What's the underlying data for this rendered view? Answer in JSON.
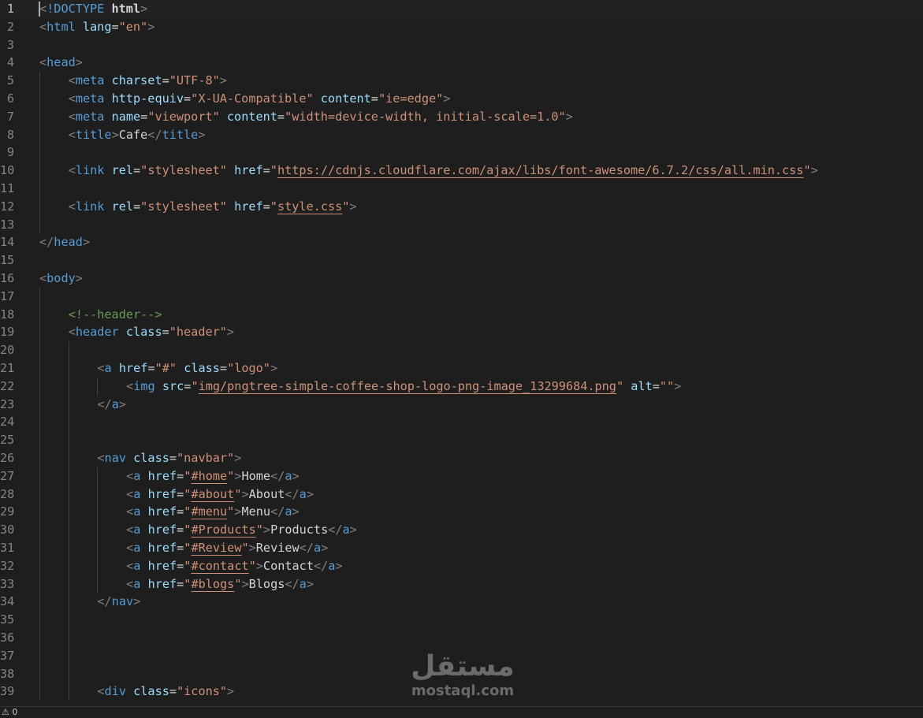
{
  "editor": {
    "language": "html",
    "active_line": 1,
    "lines": [
      {
        "n": "1",
        "indent": 0,
        "tokens": [
          [
            "punct",
            "<"
          ],
          [
            "doctype",
            "!DOCTYPE"
          ],
          [
            "text",
            " "
          ],
          [
            "bold",
            "html"
          ],
          [
            "punct",
            ">"
          ]
        ]
      },
      {
        "n": "2",
        "indent": 0,
        "tokens": [
          [
            "punct",
            "<"
          ],
          [
            "tag",
            "html"
          ],
          [
            "text",
            " "
          ],
          [
            "attr",
            "lang"
          ],
          [
            "text",
            "="
          ],
          [
            "str",
            "\"en\""
          ],
          [
            "punct",
            ">"
          ]
        ]
      },
      {
        "n": "3",
        "indent": 0,
        "tokens": []
      },
      {
        "n": "4",
        "indent": 0,
        "tokens": [
          [
            "punct",
            "<"
          ],
          [
            "tag",
            "head"
          ],
          [
            "punct",
            ">"
          ]
        ]
      },
      {
        "n": "5",
        "indent": 1,
        "tokens": [
          [
            "punct",
            "<"
          ],
          [
            "tag",
            "meta"
          ],
          [
            "text",
            " "
          ],
          [
            "attr",
            "charset"
          ],
          [
            "text",
            "="
          ],
          [
            "str",
            "\"UTF-8\""
          ],
          [
            "punct",
            ">"
          ]
        ]
      },
      {
        "n": "6",
        "indent": 1,
        "tokens": [
          [
            "punct",
            "<"
          ],
          [
            "tag",
            "meta"
          ],
          [
            "text",
            " "
          ],
          [
            "attr",
            "http-equiv"
          ],
          [
            "text",
            "="
          ],
          [
            "str",
            "\"X-UA-Compatible\""
          ],
          [
            "text",
            " "
          ],
          [
            "attr",
            "content"
          ],
          [
            "text",
            "="
          ],
          [
            "str",
            "\"ie=edge\""
          ],
          [
            "punct",
            ">"
          ]
        ]
      },
      {
        "n": "7",
        "indent": 1,
        "tokens": [
          [
            "punct",
            "<"
          ],
          [
            "tag",
            "meta"
          ],
          [
            "text",
            " "
          ],
          [
            "attr",
            "name"
          ],
          [
            "text",
            "="
          ],
          [
            "str",
            "\"viewport\""
          ],
          [
            "text",
            " "
          ],
          [
            "attr",
            "content"
          ],
          [
            "text",
            "="
          ],
          [
            "str",
            "\"width=device-width, initial-scale=1.0\""
          ],
          [
            "punct",
            ">"
          ]
        ]
      },
      {
        "n": "8",
        "indent": 1,
        "tokens": [
          [
            "punct",
            "<"
          ],
          [
            "tag",
            "title"
          ],
          [
            "punct",
            ">"
          ],
          [
            "text",
            "Cafe"
          ],
          [
            "punct",
            "</"
          ],
          [
            "tag",
            "title"
          ],
          [
            "punct",
            ">"
          ]
        ]
      },
      {
        "n": "9",
        "indent": 1,
        "tokens": []
      },
      {
        "n": "10",
        "indent": 1,
        "tokens": [
          [
            "punct",
            "<"
          ],
          [
            "tag",
            "link"
          ],
          [
            "text",
            " "
          ],
          [
            "attr",
            "rel"
          ],
          [
            "text",
            "="
          ],
          [
            "str",
            "\"stylesheet\""
          ],
          [
            "text",
            " "
          ],
          [
            "attr",
            "href"
          ],
          [
            "text",
            "="
          ],
          [
            "str",
            "\""
          ],
          [
            "link",
            "https://cdnjs.cloudflare.com/ajax/libs/font-awesome/6.7.2/css/all.min.css"
          ],
          [
            "str",
            "\""
          ],
          [
            "punct",
            ">"
          ]
        ]
      },
      {
        "n": "11",
        "indent": 1,
        "tokens": []
      },
      {
        "n": "12",
        "indent": 1,
        "tokens": [
          [
            "punct",
            "<"
          ],
          [
            "tag",
            "link"
          ],
          [
            "text",
            " "
          ],
          [
            "attr",
            "rel"
          ],
          [
            "text",
            "="
          ],
          [
            "str",
            "\"stylesheet\""
          ],
          [
            "text",
            " "
          ],
          [
            "attr",
            "href"
          ],
          [
            "text",
            "="
          ],
          [
            "str",
            "\""
          ],
          [
            "link",
            "style.css"
          ],
          [
            "str",
            "\""
          ],
          [
            "punct",
            ">"
          ]
        ]
      },
      {
        "n": "13",
        "indent": 1,
        "tokens": []
      },
      {
        "n": "14",
        "indent": 0,
        "tokens": [
          [
            "punct",
            "</"
          ],
          [
            "tag",
            "head"
          ],
          [
            "punct",
            ">"
          ]
        ]
      },
      {
        "n": "15",
        "indent": 0,
        "tokens": []
      },
      {
        "n": "16",
        "indent": 0,
        "tokens": [
          [
            "punct",
            "<"
          ],
          [
            "tag",
            "body"
          ],
          [
            "punct",
            ">"
          ]
        ]
      },
      {
        "n": "17",
        "indent": 1,
        "tokens": []
      },
      {
        "n": "18",
        "indent": 1,
        "tokens": [
          [
            "comment",
            "<!--header-->"
          ]
        ]
      },
      {
        "n": "19",
        "indent": 1,
        "tokens": [
          [
            "punct",
            "<"
          ],
          [
            "tag",
            "header"
          ],
          [
            "text",
            " "
          ],
          [
            "attr",
            "class"
          ],
          [
            "text",
            "="
          ],
          [
            "str",
            "\"header\""
          ],
          [
            "punct",
            ">"
          ]
        ]
      },
      {
        "n": "20",
        "indent": 2,
        "tokens": []
      },
      {
        "n": "21",
        "indent": 2,
        "tokens": [
          [
            "punct",
            "<"
          ],
          [
            "tag",
            "a"
          ],
          [
            "text",
            " "
          ],
          [
            "attr",
            "href"
          ],
          [
            "text",
            "="
          ],
          [
            "str",
            "\"#\""
          ],
          [
            "text",
            " "
          ],
          [
            "attr",
            "class"
          ],
          [
            "text",
            "="
          ],
          [
            "str",
            "\"logo\""
          ],
          [
            "punct",
            ">"
          ]
        ]
      },
      {
        "n": "22",
        "indent": 3,
        "tokens": [
          [
            "punct",
            "<"
          ],
          [
            "tag",
            "img"
          ],
          [
            "text",
            " "
          ],
          [
            "attr",
            "src"
          ],
          [
            "text",
            "="
          ],
          [
            "str",
            "\""
          ],
          [
            "link",
            "img/pngtree-simple-coffee-shop-logo-png-image_13299684.png"
          ],
          [
            "str",
            "\""
          ],
          [
            "text",
            " "
          ],
          [
            "attr",
            "alt"
          ],
          [
            "text",
            "="
          ],
          [
            "str",
            "\"\""
          ],
          [
            "punct",
            ">"
          ]
        ]
      },
      {
        "n": "23",
        "indent": 2,
        "tokens": [
          [
            "punct",
            "</"
          ],
          [
            "tag",
            "a"
          ],
          [
            "punct",
            ">"
          ]
        ]
      },
      {
        "n": "24",
        "indent": 2,
        "tokens": []
      },
      {
        "n": "25",
        "indent": 2,
        "tokens": []
      },
      {
        "n": "26",
        "indent": 2,
        "tokens": [
          [
            "punct",
            "<"
          ],
          [
            "tag",
            "nav"
          ],
          [
            "text",
            " "
          ],
          [
            "attr",
            "class"
          ],
          [
            "text",
            "="
          ],
          [
            "str",
            "\"navbar\""
          ],
          [
            "punct",
            ">"
          ]
        ]
      },
      {
        "n": "27",
        "indent": 3,
        "tokens": [
          [
            "punct",
            "<"
          ],
          [
            "tag",
            "a"
          ],
          [
            "text",
            " "
          ],
          [
            "attr",
            "href"
          ],
          [
            "text",
            "="
          ],
          [
            "str",
            "\""
          ],
          [
            "link",
            "#home"
          ],
          [
            "str",
            "\""
          ],
          [
            "punct",
            ">"
          ],
          [
            "text",
            "Home"
          ],
          [
            "punct",
            "</"
          ],
          [
            "tag",
            "a"
          ],
          [
            "punct",
            ">"
          ]
        ]
      },
      {
        "n": "28",
        "indent": 3,
        "tokens": [
          [
            "punct",
            "<"
          ],
          [
            "tag",
            "a"
          ],
          [
            "text",
            " "
          ],
          [
            "attr",
            "href"
          ],
          [
            "text",
            "="
          ],
          [
            "str",
            "\""
          ],
          [
            "link",
            "#about"
          ],
          [
            "str",
            "\""
          ],
          [
            "punct",
            ">"
          ],
          [
            "text",
            "About"
          ],
          [
            "punct",
            "</"
          ],
          [
            "tag",
            "a"
          ],
          [
            "punct",
            ">"
          ]
        ]
      },
      {
        "n": "29",
        "indent": 3,
        "tokens": [
          [
            "punct",
            "<"
          ],
          [
            "tag",
            "a"
          ],
          [
            "text",
            " "
          ],
          [
            "attr",
            "href"
          ],
          [
            "text",
            "="
          ],
          [
            "str",
            "\""
          ],
          [
            "link",
            "#menu"
          ],
          [
            "str",
            "\""
          ],
          [
            "punct",
            ">"
          ],
          [
            "text",
            "Menu"
          ],
          [
            "punct",
            "</"
          ],
          [
            "tag",
            "a"
          ],
          [
            "punct",
            ">"
          ]
        ]
      },
      {
        "n": "30",
        "indent": 3,
        "tokens": [
          [
            "punct",
            "<"
          ],
          [
            "tag",
            "a"
          ],
          [
            "text",
            " "
          ],
          [
            "attr",
            "href"
          ],
          [
            "text",
            "="
          ],
          [
            "str",
            "\""
          ],
          [
            "link",
            "#Products"
          ],
          [
            "str",
            "\""
          ],
          [
            "punct",
            ">"
          ],
          [
            "text",
            "Products"
          ],
          [
            "punct",
            "</"
          ],
          [
            "tag",
            "a"
          ],
          [
            "punct",
            ">"
          ]
        ]
      },
      {
        "n": "31",
        "indent": 3,
        "tokens": [
          [
            "punct",
            "<"
          ],
          [
            "tag",
            "a"
          ],
          [
            "text",
            " "
          ],
          [
            "attr",
            "href"
          ],
          [
            "text",
            "="
          ],
          [
            "str",
            "\""
          ],
          [
            "link",
            "#Review"
          ],
          [
            "str",
            "\""
          ],
          [
            "punct",
            ">"
          ],
          [
            "text",
            "Review"
          ],
          [
            "punct",
            "</"
          ],
          [
            "tag",
            "a"
          ],
          [
            "punct",
            ">"
          ]
        ]
      },
      {
        "n": "32",
        "indent": 3,
        "tokens": [
          [
            "punct",
            "<"
          ],
          [
            "tag",
            "a"
          ],
          [
            "text",
            " "
          ],
          [
            "attr",
            "href"
          ],
          [
            "text",
            "="
          ],
          [
            "str",
            "\""
          ],
          [
            "link",
            "#contact"
          ],
          [
            "str",
            "\""
          ],
          [
            "punct",
            ">"
          ],
          [
            "text",
            "Contact"
          ],
          [
            "punct",
            "</"
          ],
          [
            "tag",
            "a"
          ],
          [
            "punct",
            ">"
          ]
        ]
      },
      {
        "n": "33",
        "indent": 3,
        "tokens": [
          [
            "punct",
            "<"
          ],
          [
            "tag",
            "a"
          ],
          [
            "text",
            " "
          ],
          [
            "attr",
            "href"
          ],
          [
            "text",
            "="
          ],
          [
            "str",
            "\""
          ],
          [
            "link",
            "#blogs"
          ],
          [
            "str",
            "\""
          ],
          [
            "punct",
            ">"
          ],
          [
            "text",
            "Blogs"
          ],
          [
            "punct",
            "</"
          ],
          [
            "tag",
            "a"
          ],
          [
            "punct",
            ">"
          ]
        ]
      },
      {
        "n": "34",
        "indent": 2,
        "tokens": [
          [
            "punct",
            "</"
          ],
          [
            "tag",
            "nav"
          ],
          [
            "punct",
            ">"
          ]
        ]
      },
      {
        "n": "35",
        "indent": 2,
        "tokens": []
      },
      {
        "n": "36",
        "indent": 2,
        "tokens": []
      },
      {
        "n": "37",
        "indent": 2,
        "tokens": []
      },
      {
        "n": "38",
        "indent": 2,
        "tokens": []
      },
      {
        "n": "39",
        "indent": 2,
        "tokens": [
          [
            "punct",
            "<"
          ],
          [
            "tag",
            "div"
          ],
          [
            "text",
            " "
          ],
          [
            "attr",
            "class"
          ],
          [
            "text",
            "="
          ],
          [
            "str",
            "\"icons\""
          ],
          [
            "punct",
            ">"
          ]
        ]
      }
    ]
  },
  "watermark": {
    "arabic": "مستقل",
    "latin": "mostaql.com"
  },
  "statusbar": {
    "warnings_icon": "warning-icon",
    "warnings_count": "0"
  },
  "colors": {
    "background": "#1e1e1e",
    "tag": "#569cd6",
    "attribute": "#9cdcfe",
    "string": "#ce9178",
    "comment": "#6a9955",
    "text": "#d4d4d4",
    "line_number": "#858585"
  }
}
